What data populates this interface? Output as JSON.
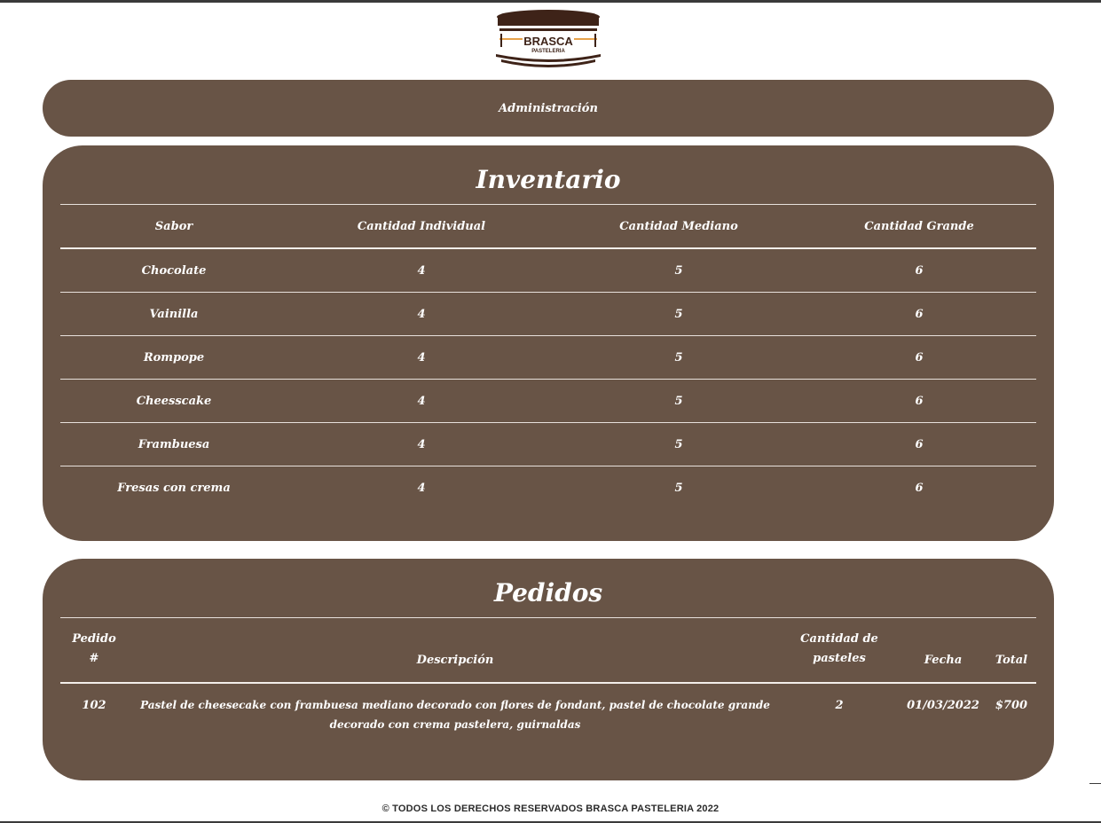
{
  "logo": {
    "line1": "BRASCA",
    "line2": "PASTELERIA"
  },
  "admin": {
    "label": "Administración"
  },
  "inventory": {
    "title": "Inventario",
    "headers": [
      "Sabor",
      "Cantidad Individual",
      "Cantidad Mediano",
      "Cantidad Grande"
    ],
    "rows": [
      [
        "Chocolate",
        "4",
        "5",
        "6"
      ],
      [
        "Vainilla",
        "4",
        "5",
        "6"
      ],
      [
        "Rompope",
        "4",
        "5",
        "6"
      ],
      [
        "Cheesscake",
        "4",
        "5",
        "6"
      ],
      [
        "Frambuesa",
        "4",
        "5",
        "6"
      ],
      [
        "Fresas con crema",
        "4",
        "5",
        "6"
      ]
    ]
  },
  "orders": {
    "title": "Pedidos",
    "headers": {
      "order_line1": "Pedido",
      "order_line2": "#",
      "description": "Descripción",
      "qty_line1": "Cantidad de",
      "qty_line2": "pasteles",
      "date": "Fecha",
      "total": "Total"
    },
    "rows": [
      {
        "order": "102",
        "description": "Pastel de cheesecake con frambuesa mediano decorado con flores de fondant, pastel de chocolate grande decorado con crema pastelera, guirnaldas",
        "qty": "2",
        "date": "01/03/2022",
        "total": "$700"
      }
    ]
  },
  "footer": {
    "text": "© TODOS LOS DERECHOS RESERVADOS BRASCA PASTELERIA 2022"
  }
}
